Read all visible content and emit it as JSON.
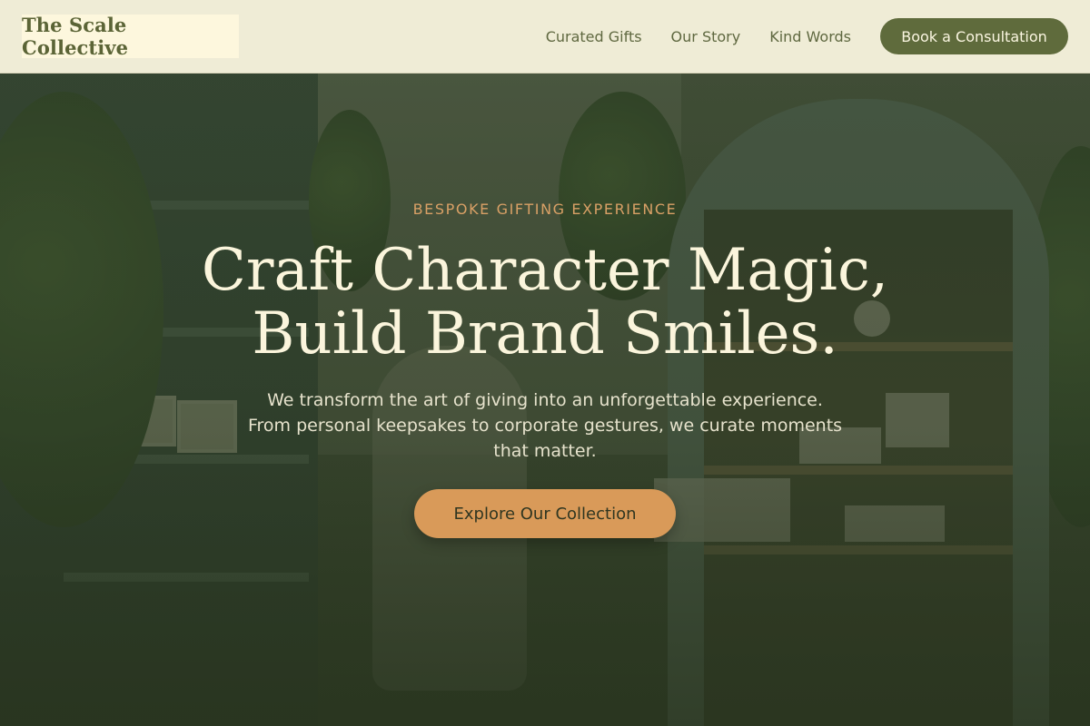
{
  "header": {
    "logo_text": "The Scale Collective",
    "nav": [
      {
        "label": "Curated Gifts"
      },
      {
        "label": "Our Story"
      },
      {
        "label": "Kind Words"
      }
    ],
    "cta_label": "Book a Consultation"
  },
  "hero": {
    "eyebrow": "BESPOKE GIFTING EXPERIENCE",
    "headline_line1": "Craft Character Magic,",
    "headline_line2": "Build Brand Smiles.",
    "subtext": "We transform the art of giving into an unforgettable experience. From personal keepsakes to corporate gestures, we curate moments that matter.",
    "cta_label": "Explore Our Collection"
  },
  "colors": {
    "header_bg": "#efecd6",
    "brand_olive": "#5f6b3c",
    "accent_amber": "#d99a59",
    "headline_cream": "#fbf5dc"
  }
}
